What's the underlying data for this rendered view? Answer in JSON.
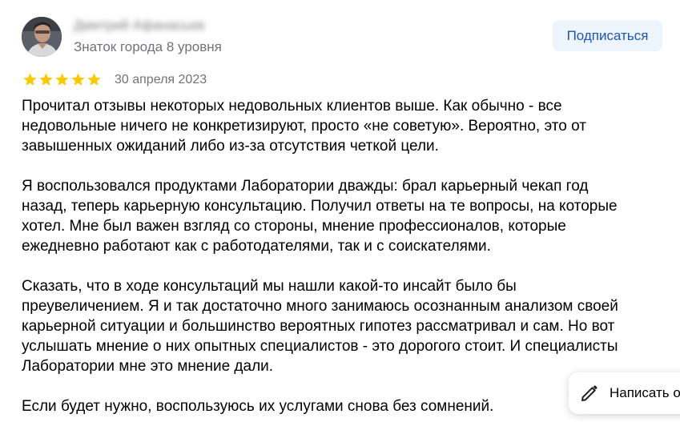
{
  "author": {
    "name": "Дмитрий Афанасьев",
    "level": "Знаток города 8 уровня"
  },
  "subscribe_label": "Подписаться",
  "review": {
    "rating": 5,
    "rating_max": 5,
    "date": "30 апреля 2023",
    "paragraphs": [
      "Прочитал отзывы некоторых недовольных клиентов выше. Как обычно - все\nнедовольные ничего не конкретизируют, просто «не советую». Вероятно, это от\nзавышенных ожиданий либо из-за отсутствия четкой цели.",
      "Я воспользовался продуктами Лаборатории дважды: брал карьерный чекап год\nназад, теперь карьерную консультацию. Получил ответы на те вопросы, на которые\nхотел. Мне был важен взгляд со стороны, мнение профессионалов, которые\nежедневно работают как с работодателями, так и с соискателями.",
      "Сказать, что в ходе консультаций мы нашли какой-то инсайт было бы\nпреувеличением. Я и так достаточно много занимаюсь осознанным анализом своей\nкарьерной ситуации и большинство вероятных гипотез рассматривал и сам. Но вот\nуслышать мнение о них опытных специалистов - это дорогого стоит. И специалисты\nЛаборатории мне это мнение дали.",
      "Если будет нужно, воспользуюсь их услугами снова без сомнений."
    ]
  },
  "write_review_label": "Написать о",
  "colors": {
    "star": "#fcc800",
    "subscribe_bg": "#eef4fc",
    "subscribe_text": "#1a56b8",
    "muted_text": "#6f737a"
  },
  "icons": {
    "avatar": "avatar-photo",
    "star": "star-icon",
    "write": "pencil-icon"
  }
}
